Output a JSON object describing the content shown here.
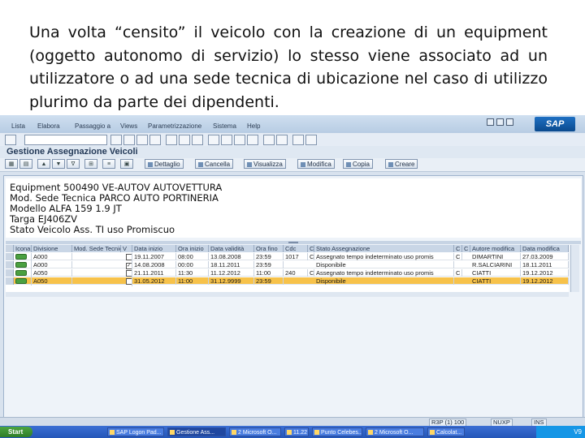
{
  "caption": "Una volta “censito” il veicolo con la creazione di un equipment (oggetto autonomo di servizio) lo stesso viene associato ad un utilizzatore o ad una sede tecnica di ubicazione nel caso di utilizzo plurimo da parte dei dipendenti.",
  "menu": [
    "Lista",
    "Elabora",
    "Passaggio a",
    "Views",
    "Parametrizzazione",
    "Sistema",
    "Help"
  ],
  "brand": "SAP",
  "title": "Gestione Assegnazione Veicoli",
  "toolbar": {
    "dettaglio": "Dettaglio",
    "cancella": "Cancella",
    "visualizza": "Visualizza",
    "modifica": "Modifica",
    "copia": "Copia",
    "creare": "Creare"
  },
  "info": {
    "equipment": "Equipment 500490 VE-AUTOV AUTOVETTURA",
    "sede": "Mod. Sede Tecnica PARCO AUTO PORTINERIA",
    "modello": "Modello ALFA 159 1.9 JT",
    "targa": "Targa EJ406ZV",
    "stato": "Stato Veicolo Ass. TI uso Promiscuo"
  },
  "grid": {
    "headers": [
      "Icona",
      "Divisione",
      "Mod. Sede Tecnica",
      "V",
      "Data inizio",
      "Ora inizio",
      "Data validità",
      "Ora fino",
      "Cdc",
      "C",
      "Stato Assegnazione",
      "C",
      "C",
      "Autore modifica",
      "Data modifica"
    ],
    "rows": [
      {
        "divisione": "A000",
        "checked": false,
        "data_inizio": "19.11.2007",
        "ora_inizio": "08:00",
        "data_fine": "13.08.2008",
        "ora_fine": "23:59",
        "cdc": "1017",
        "c": "C",
        "stato": "Assegnato tempo indeterminato uso promis",
        "c2": "C",
        "autore": "DIMARTINI",
        "data_mod": "27.03.2009",
        "highlight": false
      },
      {
        "divisione": "A000",
        "checked": true,
        "data_inizio": "14.08.2008",
        "ora_inizio": "00:00",
        "data_fine": "18.11.2011",
        "ora_fine": "23:59",
        "cdc": "",
        "c": "",
        "stato": "Disponibile",
        "c2": "",
        "autore": "R.SALCIARINI",
        "data_mod": "18.11.2011",
        "highlight": false
      },
      {
        "divisione": "A050",
        "checked": false,
        "data_inizio": "21.11.2011",
        "ora_inizio": "11:30",
        "data_fine": "11.12.2012",
        "ora_fine": "11:00",
        "cdc": "240",
        "c": "C",
        "stato": "Assegnato tempo indeterminato uso promis",
        "c2": "C",
        "autore": "CIATTI",
        "data_mod": "19.12.2012",
        "highlight": false
      },
      {
        "divisione": "A050",
        "checked": false,
        "data_inizio": "31.05.2012",
        "ora_inizio": "11:00",
        "data_fine": "31.12.9999",
        "ora_fine": "23:59",
        "cdc": "",
        "c": "",
        "stato": "Disponibile",
        "c2": "",
        "autore": "CIATTI",
        "data_mod": "19.12.2012",
        "highlight": true
      }
    ]
  },
  "status": {
    "system": "R3P (1) 100",
    "server": "NUXP",
    "mode": "INS"
  },
  "taskbar": {
    "start": "Start",
    "tasks": [
      "SAP Logon Pad...",
      "Gestione Ass...",
      "2 Microsoft O...",
      "11.22",
      "Punto Celebes...",
      "2 Microsoft O...",
      "Calcolat..."
    ],
    "clock": "V9"
  },
  "colors": {
    "highlight_row": "#f7c24a",
    "sap_blue": "#1e6fc2"
  }
}
